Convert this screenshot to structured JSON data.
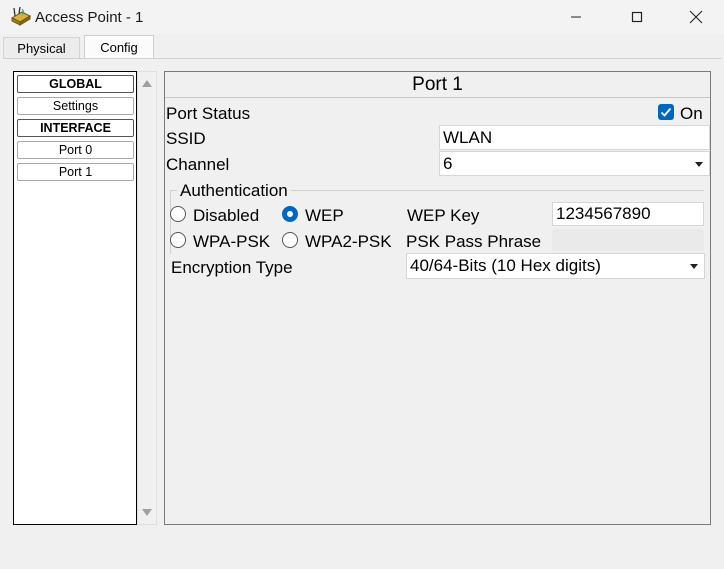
{
  "window": {
    "title": "Access Point - 1",
    "accent": "#0067c0"
  },
  "tabs": [
    {
      "label": "Physical",
      "active": false
    },
    {
      "label": "Config",
      "active": true
    }
  ],
  "sidebar": {
    "items": [
      {
        "label": "GLOBAL",
        "type": "header"
      },
      {
        "label": "Settings",
        "type": "item"
      },
      {
        "label": "INTERFACE",
        "type": "header"
      },
      {
        "label": "Port 0",
        "type": "item"
      },
      {
        "label": "Port 1",
        "type": "item",
        "selected": true
      }
    ]
  },
  "panel": {
    "title": "Port 1",
    "port_status": {
      "label": "Port Status",
      "checked": true,
      "value_label": "On"
    },
    "ssid": {
      "label": "SSID",
      "value": "WLAN"
    },
    "channel": {
      "label": "Channel",
      "value": "6"
    },
    "authentication": {
      "legend": "Authentication",
      "options": {
        "disabled": "Disabled",
        "wep": "WEP",
        "wpa_psk": "WPA-PSK",
        "wpa2_psk": "WPA2-PSK"
      },
      "selected": "WEP",
      "wep_key_label": "WEP Key",
      "wep_key_value": "1234567890",
      "psk_label": "PSK Pass Phrase",
      "psk_value": ""
    },
    "encryption": {
      "label": "Encryption Type",
      "value": "40/64-Bits (10 Hex digits)"
    }
  }
}
